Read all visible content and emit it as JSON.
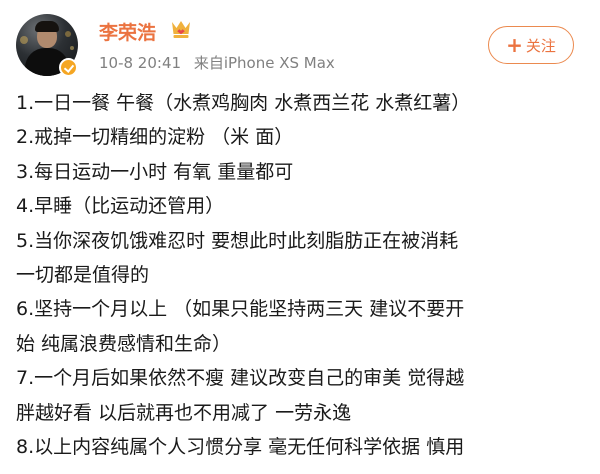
{
  "user": {
    "name": "李荣浩",
    "verified": true,
    "badge_icon": "crown-badge-icon"
  },
  "meta": {
    "time": "10-8 20:41",
    "source": "来自iPhone XS Max"
  },
  "follow_button": {
    "plus": "+",
    "label": "关注"
  },
  "colors": {
    "name": "#eb7340",
    "meta": "#808080",
    "text": "#1a1a1a",
    "follow_border": "#eb8a4f",
    "verify_badge": "#f5a623"
  },
  "content": {
    "lines": [
      "1.一日一餐 午餐（水煮鸡胸肉 水煮西兰花 水煮红薯）",
      "2.戒掉一切精细的淀粉 （米 面）",
      "3.每日运动一小时 有氧 重量都可",
      "4.早睡（比运动还管用）",
      "5.当你深夜饥饿难忍时 要想此时此刻脂肪正在被消耗",
      "一切都是值得的",
      "6.坚持一个月以上 （如果只能坚持两三天 建议不要开",
      "始 纯属浪费感情和生命）",
      "7.一个月后如果依然不瘦 建议改变自己的审美 觉得越",
      "胖越好看 以后就再也不用减了 一劳永逸",
      "8.以上内容纯属个人习惯分享 毫无任何科学依据 慎用"
    ]
  }
}
